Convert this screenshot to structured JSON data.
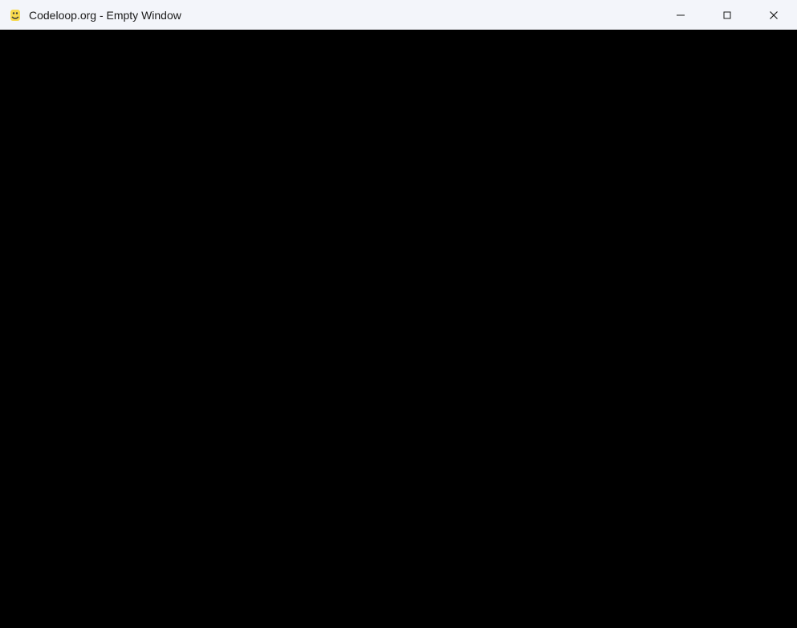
{
  "window": {
    "title": "Codeloop.org - Empty Window",
    "app_icon_name": "python-icon"
  }
}
